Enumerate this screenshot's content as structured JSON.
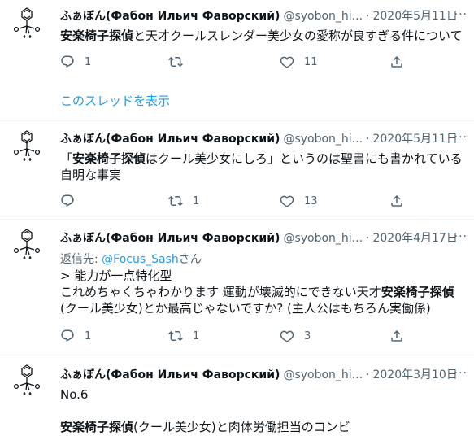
{
  "tweets": [
    {
      "name": "ふぁぼん(Фабон Ильич Фаворский)",
      "handle": "@syobon_hi...",
      "date": "2020年5月11日",
      "bold": "安楽椅子探偵",
      "text": "と天才クールスレンダー美少女の愛称が良すぎる件について",
      "replies": "1",
      "retweets": "",
      "likes": "11",
      "thread_link": "このスレッドを表示"
    },
    {
      "name": "ふぁぼん(Фабон Ильич Фаворский)",
      "handle": "@syobon_hi...",
      "date": "2020年5月11日",
      "pre": "「",
      "bold": "安楽椅子探偵",
      "line1_rest": "はクール美少女にしろ」というのは聖書にも書かれている",
      "line2": "自明な事実",
      "replies": "",
      "retweets": "1",
      "likes": "13"
    },
    {
      "name": "ふぁぼん(Фабон Ильич Фаворский)",
      "handle": "@syobon_hi...",
      "date": "2020年4月17日",
      "reply_prefix": "返信先: ",
      "reply_mention": "@Focus_Sash",
      "reply_suffix": "さん",
      "line1": "> 能力が一点特化型",
      "line2_pre": "これめちゃくちゃわかります 運動が壊滅的にできない天才",
      "bold": "安楽椅子探偵",
      "line3": "(クール美少女)とか最高じゃないですか? (主人公はもちろん実働係)",
      "replies": "1",
      "retweets": "1",
      "likes": "3"
    },
    {
      "name": "ふぁぼん(Фабон Ильич Фаворский)",
      "handle": "@syobon_hi...",
      "date": "2020年3月10日",
      "line1": "No.6",
      "bold": "安楽椅子探偵",
      "line3_rest": "(クール美少女)と肉体労働担当のコンビ"
    }
  ],
  "more_label": "···",
  "dot": "·"
}
